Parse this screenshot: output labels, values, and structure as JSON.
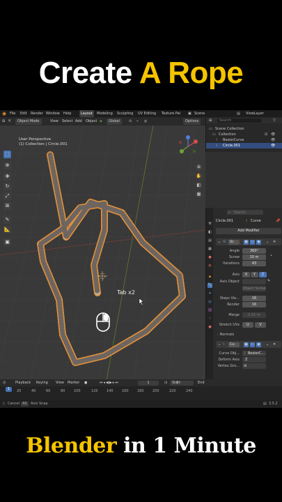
{
  "title_top": {
    "white": "Create",
    "yellow": "A Rope"
  },
  "title_bottom": {
    "yellow": "Blender",
    "white": "in 1 Minute"
  },
  "menu": {
    "items": [
      "File",
      "Edit",
      "Render",
      "Window",
      "Help"
    ],
    "workspaces": [
      "Layout",
      "Modeling",
      "Sculpting",
      "UV Editing",
      "Texture Pai"
    ],
    "active_workspace": "Layout",
    "scene": "Scene",
    "view_layer": "ViewLayer"
  },
  "viewport_header": {
    "mode": "Object Mode",
    "menus": [
      "View",
      "Select",
      "Add",
      "Object"
    ],
    "transform": "Global",
    "options": "Options"
  },
  "viewport": {
    "view_name": "User Perspective",
    "collection_info": "(1) Collection | Circle.001",
    "hint": "Tab x2"
  },
  "outliner": {
    "search_placeholder": "Search",
    "items": [
      {
        "label": "Scene Collection"
      },
      {
        "label": "Collection"
      },
      {
        "label": "BezierCurve"
      },
      {
        "label": "Circle.001"
      }
    ]
  },
  "properties": {
    "search_placeholder": "Search",
    "object_name": "Circle.001",
    "data_type": "Curve",
    "add_modifier": "Add Modifier",
    "modifier1_name": "Sc",
    "angle_label": "Angle",
    "angle_value": "360°",
    "screw_label": "Screw",
    "screw_value": "10 m",
    "iterations_label": "Iterations",
    "iterations_value": "43",
    "axis_label": "Axis",
    "axis_options": [
      "X",
      "Y",
      "Z"
    ],
    "axis_selected": "Z",
    "axis_object_label": "Axis Object",
    "object_screw": "Object Screw",
    "steps_viewport_label": "Steps Vie...",
    "steps_viewport_value": "16",
    "render_label": "Render",
    "render_value": "16",
    "merge_label": "Merge",
    "merge_value": "0.01 m",
    "stretch_uvs_label": "Stretch UVs",
    "stretch_u": "U",
    "stretch_v": "V",
    "normals_label": "Normals",
    "modifier2_name": "Cu",
    "curve_object_label": "Curve Obj...",
    "curve_object_value": "BezierC...",
    "deform_axis_label": "Deform Axis",
    "deform_axis_value": "Z",
    "vertex_group_label": "Vertex Gro..."
  },
  "timeline": {
    "menus": [
      "Playback",
      "Keying",
      "View",
      "Marker"
    ],
    "current_frame": "1",
    "start_label": "Start",
    "start_value": "1",
    "end_label": "End",
    "frame_numbers": [
      "20",
      "40",
      "60",
      "80",
      "100",
      "120",
      "140",
      "160",
      "180",
      "200",
      "220",
      "240"
    ],
    "playhead": "1"
  },
  "statusbar": {
    "cancel": "Cancel",
    "alt_key": "Alt",
    "axis_snap": "Axis Snap",
    "version": "3.5.2"
  },
  "colors": {
    "accent_yellow": "#f5c400",
    "blender_blue": "#4772b3",
    "selection_orange": "#e8902f"
  }
}
